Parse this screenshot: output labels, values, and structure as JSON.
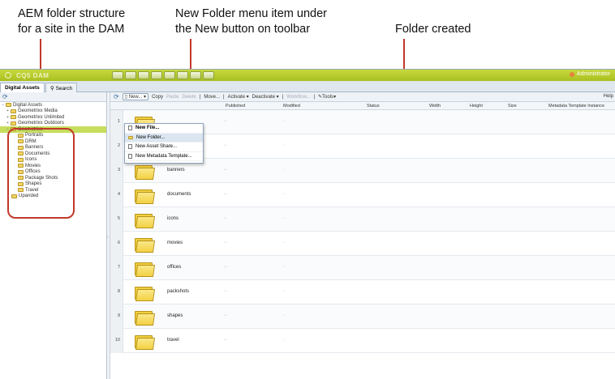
{
  "annotations": {
    "left": [
      "AEM folder structure",
      "for a site in the DAM"
    ],
    "middle": [
      "New Folder menu item under",
      "the New button on toolbar"
    ],
    "right": [
      "Folder created"
    ]
  },
  "app": {
    "logo": "CQ5 DAM",
    "admin": "Administrator",
    "tabs": [
      "Digital Assets",
      "Search"
    ]
  },
  "tree": {
    "items": [
      {
        "label": "Digital Assets",
        "level": 0
      },
      {
        "label": "Geometrixx Media",
        "level": 1
      },
      {
        "label": "Geometrixx Unlimited",
        "level": 1
      },
      {
        "label": "Geometrixx Outdoors",
        "level": 1
      },
      {
        "label": "Geometrixx",
        "level": 1,
        "selected": true
      },
      {
        "label": "Portraits",
        "level": 2
      },
      {
        "label": "DRM",
        "level": 2
      },
      {
        "label": "Banners",
        "level": 2
      },
      {
        "label": "Documents",
        "level": 2
      },
      {
        "label": "Icons",
        "level": 2
      },
      {
        "label": "Movies",
        "level": 2
      },
      {
        "label": "Offices",
        "level": 2
      },
      {
        "label": "Package Shots",
        "level": 2
      },
      {
        "label": "Shapes",
        "level": 2
      },
      {
        "label": "Travel",
        "level": 2
      },
      {
        "label": "Upanded",
        "level": 1
      }
    ]
  },
  "toolbar": {
    "new": "New...",
    "copy": "Copy",
    "paste": "Paste",
    "delete": "Delete",
    "move": "Move...",
    "activate": "Activate",
    "deactivate": "Deactivate",
    "workflow": "Workflow...",
    "tools": "Tools",
    "help": "Help"
  },
  "columns": [
    "Published",
    "Modified",
    "Status",
    "Width",
    "Height",
    "Size",
    "Metadata Template Instance"
  ],
  "menu": [
    "New File...",
    "New Folder...",
    "New Asset Share...",
    "New Metadata Template..."
  ],
  "rows": [
    {
      "n": "1",
      "name": ""
    },
    {
      "n": "2",
      "name": ""
    },
    {
      "n": "3",
      "name": "banners"
    },
    {
      "n": "4",
      "name": "documents"
    },
    {
      "n": "5",
      "name": "icons"
    },
    {
      "n": "6",
      "name": "movies"
    },
    {
      "n": "7",
      "name": "offices"
    },
    {
      "n": "8",
      "name": "packshots"
    },
    {
      "n": "9",
      "name": "shapes"
    },
    {
      "n": "10",
      "name": "travel"
    }
  ],
  "colors": {
    "annotation_red": "#c0392b",
    "topbar": "#b5c92c",
    "selection": "#c6dd5e"
  }
}
